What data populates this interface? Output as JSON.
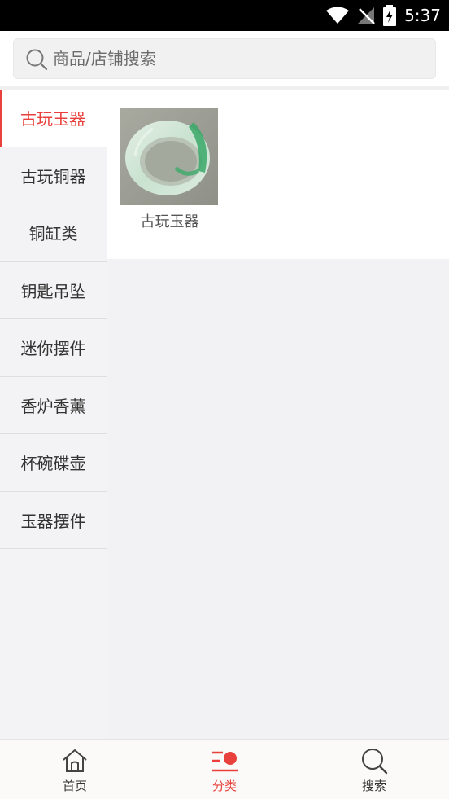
{
  "status_bar": {
    "time": "5:37",
    "icons": [
      "wifi-icon",
      "signal-off-icon",
      "battery-charging-icon"
    ]
  },
  "search": {
    "placeholder": "商品/店铺搜索",
    "icon": "search-icon"
  },
  "sidebar": {
    "items": [
      {
        "label": "古玩玉器",
        "active": true
      },
      {
        "label": "古玩铜器",
        "active": false
      },
      {
        "label": "铜缸类",
        "active": false
      },
      {
        "label": "钥匙吊坠",
        "active": false
      },
      {
        "label": "迷你摆件",
        "active": false
      },
      {
        "label": "香炉香薰",
        "active": false
      },
      {
        "label": "杯碗碟壶",
        "active": false
      },
      {
        "label": "玉器摆件",
        "active": false
      }
    ]
  },
  "content": {
    "products": [
      {
        "label": "古玩玉器",
        "image": "jade-bangle-image"
      }
    ]
  },
  "tabbar": {
    "tabs": [
      {
        "label": "首页",
        "icon": "home-icon",
        "active": false
      },
      {
        "label": "分类",
        "icon": "category-icon",
        "active": true
      },
      {
        "label": "搜索",
        "icon": "search-icon",
        "active": false
      }
    ]
  },
  "colors": {
    "accent": "#e8413c",
    "sidebar_bg": "#f3f3f5",
    "status_bar_bg": "#000000"
  }
}
